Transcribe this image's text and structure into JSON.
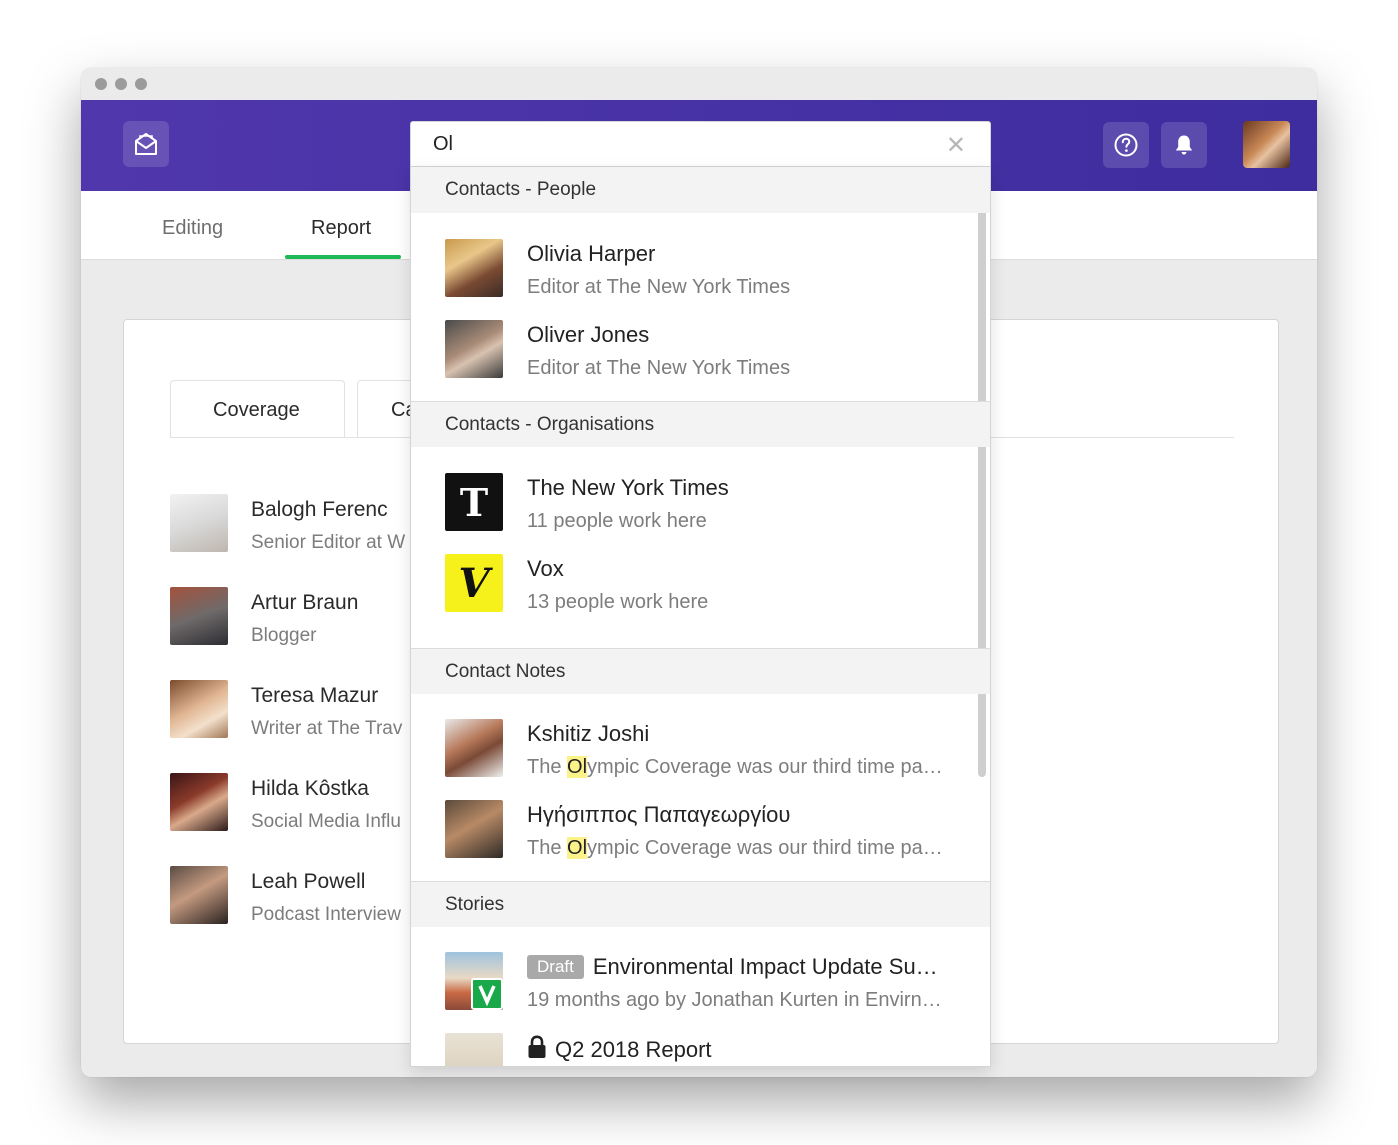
{
  "header": {
    "logo_icon": "envelope-open-icon",
    "help_icon": "question-icon",
    "bell_icon": "bell-icon",
    "brand_color": "#4a33a6"
  },
  "tabs": [
    {
      "label": "Editing"
    },
    {
      "label": "Report"
    }
  ],
  "subtabs": [
    {
      "label": "Coverage"
    },
    {
      "label": "Ca"
    }
  ],
  "people": [
    {
      "name": "Balogh Ferenc",
      "role": "Senior Editor at W"
    },
    {
      "name": "Artur Braun",
      "role": "Blogger"
    },
    {
      "name": "Teresa Mazur",
      "role": "Writer at The Trav"
    },
    {
      "name": "Hilda Kôstka",
      "role": "Social Media Influ"
    },
    {
      "name": "Leah Powell",
      "role": "Podcast Interview"
    }
  ],
  "search": {
    "query": "Ol",
    "clear_icon": "close-icon",
    "sections": {
      "people": "Contacts - People",
      "orgs": "Contacts - Organisations",
      "notes": "Contact Notes",
      "stories": "Stories"
    },
    "people": [
      {
        "name": "Olivia Harper",
        "sub": "Editor at The New York Times"
      },
      {
        "name": "Oliver Jones",
        "sub": "Editor at The New York Times"
      }
    ],
    "orgs": [
      {
        "name": "The New York Times",
        "sub": "11 people work here",
        "logo": "T"
      },
      {
        "name": "Vox",
        "sub": "13 people work here",
        "logo": "V"
      }
    ],
    "notes": [
      {
        "name": "Kshitiz Joshi",
        "pre": "The ",
        "hl": "Ol",
        "post": "ympic Coverage was our third time pa…"
      },
      {
        "name": "Ηγήσιππος Παπαγεωργίου",
        "pre": "The ",
        "hl": "Ol",
        "post": "ympic Coverage was our third time pa…"
      }
    ],
    "stories": [
      {
        "badge": "Draft",
        "title": "Environmental Impact Update Su…",
        "sub": "19 months ago by Jonathan Kurten in Envirn…"
      },
      {
        "title": "Q2 2018 Report",
        "lock_icon": "lock-icon"
      }
    ]
  }
}
